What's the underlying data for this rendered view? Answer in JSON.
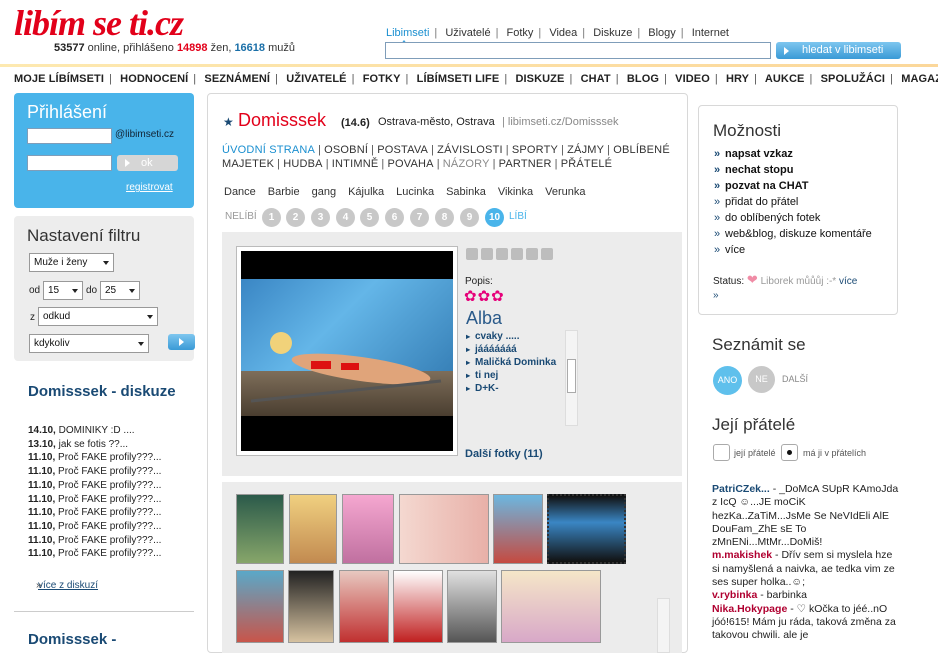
{
  "header": {
    "logo": "libím se ti.cz",
    "stats_online": "53577",
    "stats_online_label": " online, přihlášeno ",
    "stats_women": "14898",
    "stats_women_label": " žen, ",
    "stats_men": "16618",
    "stats_men_label": " mužů",
    "topnav": [
      "Libimseti",
      "Uživatelé",
      "Fotky",
      "Videa",
      "Diskuze",
      "Blogy",
      "Internet"
    ],
    "search_placeholder": "",
    "search_button": "hledat v libimseti"
  },
  "mainnav": [
    "MOJE LÍBÍMSETI",
    "HODNOCENÍ",
    "SEZNÁMENÍ",
    "UŽIVATELÉ",
    "FOTKY",
    "LÍBÍMSETI LIFE",
    "DISKUZE",
    "CHAT",
    "BLOG",
    "VIDEO",
    "HRY",
    "AUKCE",
    "SPOLUŽÁCI",
    "MAGAZÍN"
  ],
  "login": {
    "title": "Přihlášení",
    "domain": "@libimseti.cz",
    "ok": "ok",
    "register": "registrovat"
  },
  "filter": {
    "title": "Nastavení filtru",
    "gender": "Muže i ženy",
    "od_label": "od",
    "od_value": "15",
    "do_label": "do",
    "do_value": "25",
    "z_label": "z",
    "odkud": "odkud",
    "kdy": "kdykoliv"
  },
  "discussion": {
    "title": "Domisssek - diskuze",
    "items": [
      {
        "date": "14.10,",
        "text": " DOMINIKY :D ...."
      },
      {
        "date": "13.10,",
        "text": " jak se fotis ??..."
      },
      {
        "date": "11.10,",
        "text": " Proč FAKE profily???..."
      },
      {
        "date": "11.10,",
        "text": " Proč FAKE profily???..."
      },
      {
        "date": "11.10,",
        "text": " Proč FAKE profily???..."
      },
      {
        "date": "11.10,",
        "text": " Proč FAKE profily???..."
      },
      {
        "date": "11.10,",
        "text": " Proč FAKE profily???..."
      },
      {
        "date": "11.10,",
        "text": " Proč FAKE profily???..."
      },
      {
        "date": "11.10,",
        "text": " Proč FAKE profily???..."
      },
      {
        "date": "11.10,",
        "text": " Proč FAKE profily???..."
      }
    ],
    "more": "více z diskuzí",
    "next_title": "Domisssek -"
  },
  "profile": {
    "name": "Domisssek",
    "score": "(14.6)",
    "location": "Ostrava-město, Ostrava",
    "url": "| libimseti.cz/Domisssek",
    "tabs": [
      "ÚVODNÍ STRANA",
      "OSOBNÍ",
      "POSTAVA",
      "ZÁVISLOSTI",
      "SPORTY",
      "ZÁJMY",
      "OBLÍBENÉ MAJETEK",
      "HUDBA",
      "INTIMNĚ",
      "POVAHA",
      "NÁZORY",
      "PARTNER",
      "PŘÁTELÉ"
    ],
    "friend_names": [
      "Dance",
      "Barbie",
      "gang",
      "Kájulka",
      "Lucinka",
      "Sabinka",
      "Vikinka",
      "Verunka"
    ],
    "rating_left": "NELÍBÍ",
    "rating_right": "LÍBÍ",
    "rating_numbers": [
      "1",
      "2",
      "3",
      "4",
      "5",
      "6",
      "7",
      "8",
      "9",
      "10"
    ],
    "rating_selected": "10",
    "popis_label": "Popis:",
    "flowers": "✿✿✿",
    "photo_title": "Alba",
    "photo_comments": [
      "cvaky .....",
      "jááááááá",
      "Maličká Dominka",
      "ti nej",
      "D+K-"
    ],
    "more_photos": "Další fotky (11)"
  },
  "options": {
    "title": "Možnosti",
    "items": [
      {
        "label": "napsat vzkaz",
        "bold": true
      },
      {
        "label": "nechat stopu",
        "bold": true
      },
      {
        "label": "pozvat na CHAT",
        "bold": true
      },
      {
        "label": "přidat do přátel",
        "bold": false
      },
      {
        "label": "do oblíbených fotek",
        "bold": false
      },
      {
        "label": "web&blog, diskuze komentáře",
        "bold": false
      },
      {
        "label": "více",
        "bold": false
      }
    ],
    "status_label": "Status:",
    "status_text": "Liborek můůůj :-*",
    "status_more": "více"
  },
  "meet": {
    "title": "Seznámit se",
    "yes": "ANO",
    "no": "NE",
    "next": "DALŠÍ"
  },
  "friends": {
    "title": "Její přátelé",
    "opt1": "její přátelé",
    "opt2": "má ji v přátelích",
    "feed": [
      {
        "name": "PatriCZek...",
        "text": " - _DoMcA SUpR KAmoJda z IcQ ☺...JE moCiK hezKa..ZaTiM...JsMe Se NeVIdEli AlE DouFam_ZhE sE To zMnENi...MtMr...DoMiš!"
      },
      {
        "name": "m.makishek",
        "text": " - Dřív sem si myslela hze si namyšlená a naivka, ae tedka vim ze ses super holka..☺;"
      },
      {
        "name": "v.rybinka",
        "text": " - barbinka"
      },
      {
        "name": "Nika.Hokypage",
        "text": " - ♡ kOčka to jéé..nO jóó!615! Mám ju ráda, taková změna za takovou chwili. ale je"
      }
    ]
  },
  "colors": {
    "brand_red": "#e2001a",
    "accent_blue": "#49b4ea",
    "link_navy": "#1a4a74"
  }
}
